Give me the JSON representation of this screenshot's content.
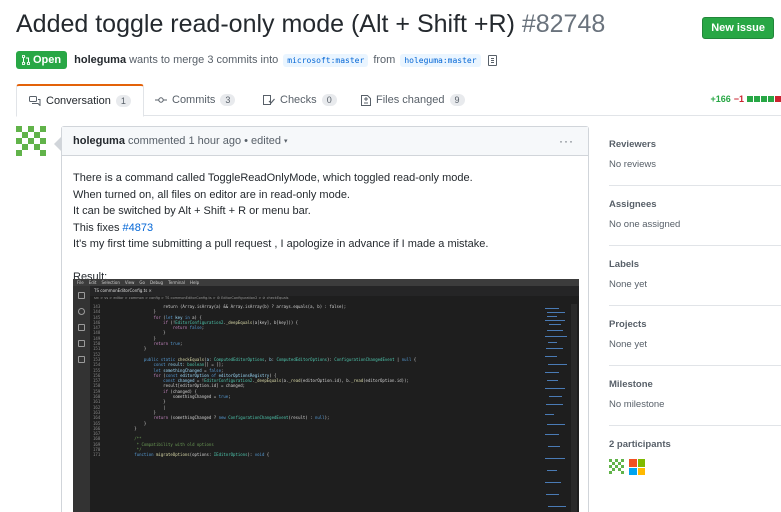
{
  "pr": {
    "title": "Added toggle read-only mode (Alt + Shift +R)",
    "number": "#82748",
    "new_issue_label": "New issue",
    "state": "Open",
    "author": "holeguma",
    "merge_text": "wants to merge 3 commits into",
    "base_branch": "microsoft:master",
    "from_text": "from",
    "head_branch": "holeguma:master"
  },
  "tabs": [
    {
      "label": "Conversation",
      "count": "1",
      "icon": "comment-discussion-icon"
    },
    {
      "label": "Commits",
      "count": "3",
      "icon": "git-commit-icon"
    },
    {
      "label": "Checks",
      "count": "0",
      "icon": "checklist-icon"
    },
    {
      "label": "Files changed",
      "count": "9",
      "icon": "file-diff-icon"
    }
  ],
  "diffstat": {
    "additions": "+166",
    "deletions": "−1",
    "blocks_green": 4,
    "blocks_red": 1
  },
  "comment": {
    "author": "holeguma",
    "meta": "commented 1 hour ago • edited",
    "more_label": "···",
    "body_lines": [
      "There is a command called ToggleReadOnlyMode, which toggled read-only mode.",
      "When turned on, all files on editor are in read-only mode.",
      "It can be switched by Alt + Shift + R or menu bar."
    ],
    "fixes_text": "This fixes",
    "fixes_link": "#4873",
    "apology": "It's my first time submitting a pull request , I apologize in advance if I made a mistake.",
    "result_label": "Result:"
  },
  "screenshot": {
    "menu": [
      "File",
      "Edit",
      "Selection",
      "View",
      "Go",
      "Debug",
      "Terminal",
      "Help"
    ],
    "tab_label": "TS  commonEditorConfig.ts  ×",
    "breadcrumb": "src > vs > editor > common > config > TS commonEditorConfig.ts > ⚙ EditorConfiguration2 > ⊘ checkEquals"
  },
  "sidebar": {
    "reviewers": {
      "title": "Reviewers",
      "value": "No reviews"
    },
    "assignees": {
      "title": "Assignees",
      "value": "No one assigned"
    },
    "labels": {
      "title": "Labels",
      "value": "None yet"
    },
    "projects": {
      "title": "Projects",
      "value": "None yet"
    },
    "milestone": {
      "title": "Milestone",
      "value": "No milestone"
    },
    "participants": {
      "title": "2 participants"
    }
  },
  "colors": {
    "open_green": "#28a745",
    "link_blue": "#0366d6",
    "tab_accent": "#e36209"
  }
}
